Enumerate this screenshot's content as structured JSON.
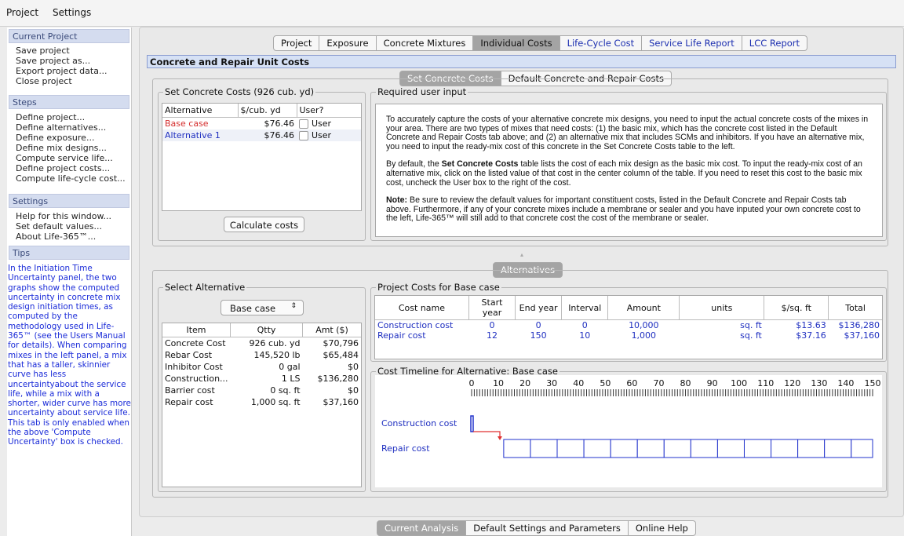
{
  "menubar": {
    "project": "Project",
    "settings": "Settings"
  },
  "sidebar": {
    "current_project": {
      "header": "Current Project",
      "items": [
        "Save project",
        "Save project as...",
        "Export project data...",
        "Close project"
      ]
    },
    "steps": {
      "header": "Steps",
      "items": [
        "Define project...",
        "Define alternatives...",
        "Define exposure...",
        "Define mix designs...",
        "Compute service life...",
        "Define project costs...",
        "Compute life-cycle cost..."
      ]
    },
    "settings": {
      "header": "Settings",
      "items": [
        "Help for this window...",
        "Set default values...",
        "About Life-365™..."
      ]
    },
    "tips": {
      "header": "Tips",
      "para1": "In the Initiation Time Uncertainty panel, the two graphs show the computed uncertainty in concrete mix design initiation times, as computed by the methodology used in Life-365™ (see the Users Manual for details). When comparing mixes in the left panel, a mix that has a taller, skinnier curve has less uncertaintyabout the service life, while a mix with a shorter, wider curve has more uncertainty about service life.",
      "para2": "This tab is only enabled when the above 'Compute Uncertainty' box is checked."
    }
  },
  "main_tabs": [
    "Project",
    "Exposure",
    "Concrete Mixtures",
    "Individual Costs",
    "Life-Cycle Cost",
    "Service Life Report",
    "LCC Report"
  ],
  "section_title": "Concrete and Repair Unit Costs",
  "sub_tabs": [
    "Set Concrete Costs",
    "Default Concrete and Repair Costs"
  ],
  "set_costs": {
    "label": "Set Concrete Costs (926 cub. yd)",
    "headers": [
      "Alternative",
      "$/cub. yd",
      "User?"
    ],
    "rows": [
      {
        "name": "Base case",
        "cost": "$76.46",
        "user": "User"
      },
      {
        "name": "Alternative 1",
        "cost": "$76.46",
        "user": "User"
      }
    ],
    "calc_button": "Calculate costs"
  },
  "required": {
    "label": "Required user input",
    "p1": "To accurately capture the costs of your alternative concrete mix designs, you need to input the actual concrete costs of the mixes in your area. There are two types of mixes that need costs: (1) the basic mix, which has the concrete cost listed in the Default Concrete and Repair Costs tab above; and (2) an alternative mix that includes SCMs and inhibitors. If you have an alternative mix, you need to input the ready-mix cost of this concrete in the Set Concrete Costs table to the left.",
    "p2a": "By default, the ",
    "p2b": "Set Concrete Costs",
    "p2c": " table lists the cost of each mix design as the basic mix cost. To input the ready-mix cost of an alternative mix, click on the listed value of that cost in the center column of the table. If you need to reset this cost to the basic mix cost, uncheck the User box to the right of the cost.",
    "p3a": "Note:",
    "p3b": " Be sure to review the default values for important constituent costs, listed in the Default Concrete and Repair Costs tab above. Furthermore, if any of your concrete mixes include a membrane or sealer and you have inputed your own concrete cost to the left, Life-365™ will still add to that concrete cost the cost of the membrane or sealer."
  },
  "alternatives_tab": "Alternatives",
  "select_alt": {
    "label": "Select Alternative",
    "selected": "Base case",
    "headers": [
      "Item",
      "Qtty",
      "Amt ($)"
    ],
    "rows": [
      [
        "Concrete Cost",
        "926 cub. yd",
        "$70,796"
      ],
      [
        "Rebar Cost",
        "145,520 lb",
        "$65,484"
      ],
      [
        "Inhibitor Cost",
        "0 gal",
        "$0"
      ],
      [
        "Construction...",
        "1 LS",
        "$136,280"
      ],
      [
        "Barrier cost",
        "0 sq. ft",
        "$0"
      ],
      [
        "Repair cost",
        "1,000 sq. ft",
        "$37,160"
      ]
    ]
  },
  "project_costs": {
    "label": "Project Costs for Base case",
    "headers": [
      "Cost name",
      "Start year",
      "End year",
      "Interval",
      "Amount",
      "units",
      "$/sq. ft",
      "Total"
    ],
    "rows": [
      [
        "Construction cost",
        "0",
        "0",
        "0",
        "10,000",
        "sq. ft",
        "$13.63",
        "$136,280"
      ],
      [
        "Repair cost",
        "12",
        "150",
        "10",
        "1,000",
        "sq. ft",
        "$37.16",
        "$37,160"
      ]
    ]
  },
  "timeline": {
    "label": "Cost Timeline for Alternative: Base case",
    "ticks": [
      "0",
      "10",
      "20",
      "30",
      "40",
      "50",
      "60",
      "70",
      "80",
      "90",
      "100",
      "110",
      "120",
      "130",
      "140",
      "150"
    ],
    "rows": [
      "Construction cost",
      "Repair cost"
    ],
    "repair_start_year": 12,
    "repair_interval": 10,
    "repair_end_year": 150
  },
  "bottom_tabs": [
    "Current Analysis",
    "Default Settings and Parameters",
    "Online Help"
  ]
}
